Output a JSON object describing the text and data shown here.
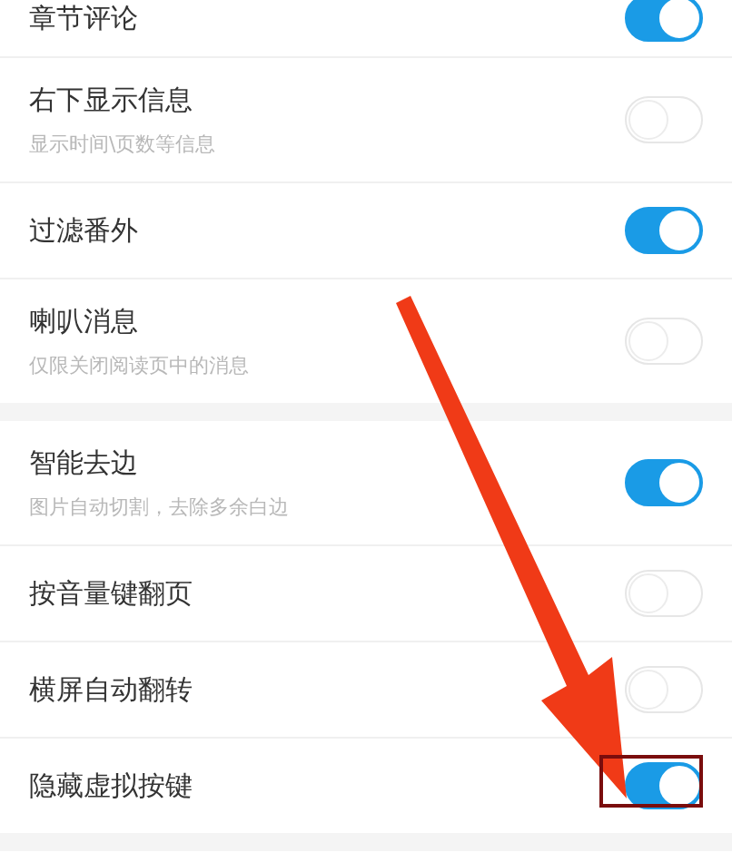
{
  "sections": [
    {
      "rows": [
        {
          "title": "章节评论",
          "on": true
        },
        {
          "title": "右下显示信息",
          "subtitle": "显示时间\\页数等信息",
          "on": false
        },
        {
          "title": "过滤番外",
          "on": true
        },
        {
          "title": "喇叭消息",
          "subtitle": "仅限关闭阅读页中的消息",
          "on": false
        }
      ]
    },
    {
      "rows": [
        {
          "title": "智能去边",
          "subtitle": "图片自动切割，去除多余白边",
          "on": true
        },
        {
          "title": "按音量键翻页",
          "on": false
        },
        {
          "title": "横屏自动翻转",
          "on": false
        },
        {
          "title": "隐藏虚拟按键",
          "on": true
        }
      ]
    }
  ]
}
